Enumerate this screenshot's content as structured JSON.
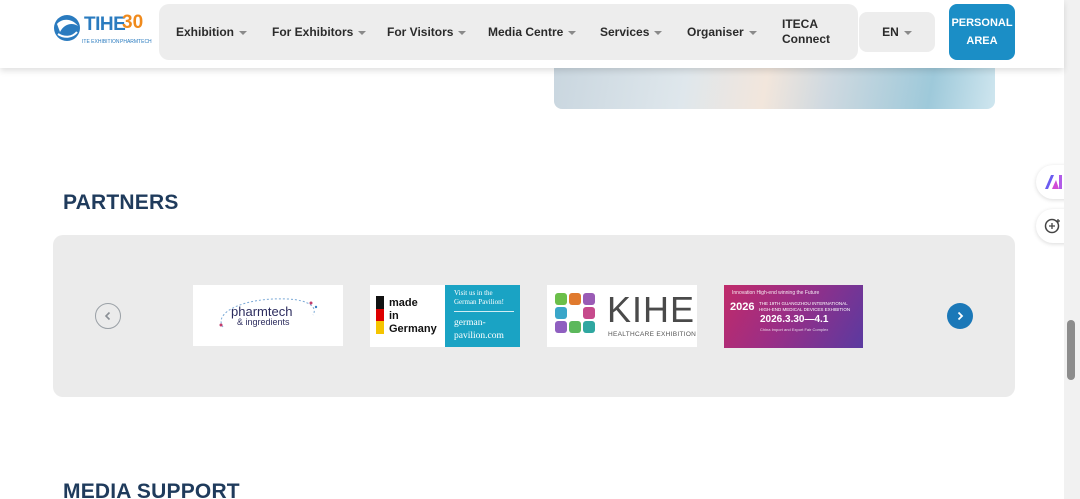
{
  "header": {
    "logo": {
      "name": "TIHE",
      "anniversary": "30",
      "sub_left": "ITE EXHIBITION",
      "sub_right": "PHARMTECH"
    },
    "nav": [
      {
        "label": "Exhibition",
        "has_dropdown": true
      },
      {
        "label": "For Exhibitors",
        "has_dropdown": true
      },
      {
        "label": "For Visitors",
        "has_dropdown": true
      },
      {
        "label": "Media Centre",
        "has_dropdown": true
      },
      {
        "label": "Services",
        "has_dropdown": true
      },
      {
        "label": "Organiser",
        "has_dropdown": true
      },
      {
        "label_line1": "ITECA",
        "label_line2": "Connect",
        "has_dropdown": false
      }
    ],
    "lang": "EN",
    "personal_line1": "PERSONAL",
    "personal_line2": "AREA"
  },
  "partners": {
    "title": "PARTNERS",
    "logos": {
      "pharmtech": {
        "line1": "pharmtech",
        "line2": "& ingredients"
      },
      "german": {
        "left": [
          "made",
          "in",
          "Germany"
        ],
        "right_top": "Visit us in the German Pavilion!",
        "right_bottom": "german-pavilion.com"
      },
      "kihe": {
        "title": "KIHE",
        "subtitle": "HEALTHCARE EXHIBITION"
      },
      "guangzhou": {
        "tagline": "Innovation High-end winning the Future",
        "year": "2026",
        "text": "THE 19TH GUANGZHOU INTERNATIONAL HIGH-END MEDICAL DEVICES EXHIBITION",
        "dates": "2026.3.30—4.1",
        "venue": "China Import and Export Fair Complex"
      }
    }
  },
  "media_support": {
    "title": "MEDIA SUPPORT"
  },
  "colors": {
    "accent": "#1b8ec6",
    "title": "#1f3b5c",
    "nav_bg": "#ededed",
    "arrow_next": "#1b78b8"
  }
}
